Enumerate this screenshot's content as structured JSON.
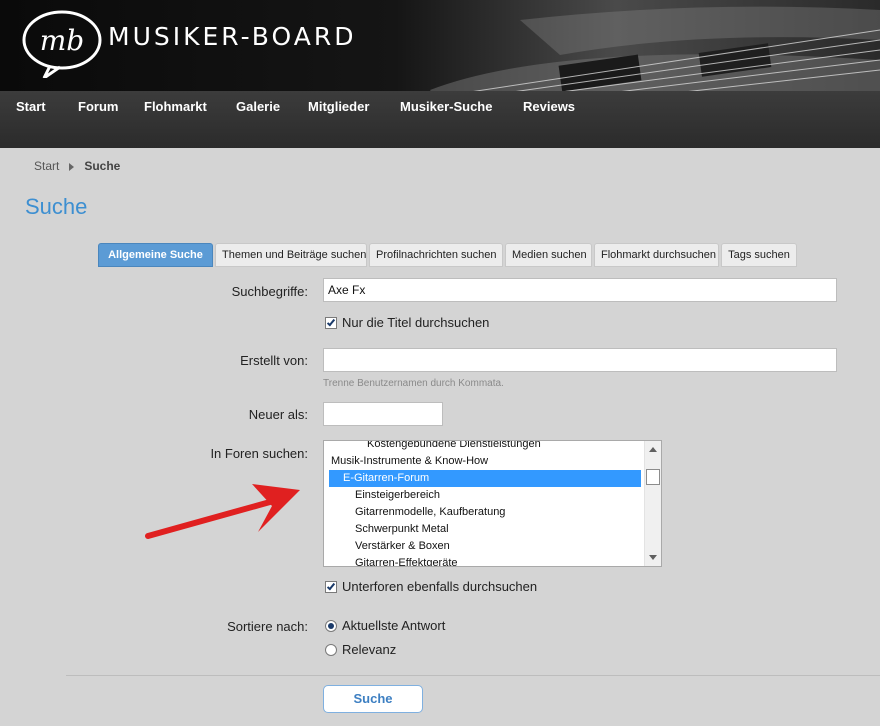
{
  "site": {
    "name": "MUSIKER-BOARD",
    "logo_mark": "mb"
  },
  "nav": {
    "items": [
      "Start",
      "Forum",
      "Flohmarkt",
      "Galerie",
      "Mitglieder",
      "Musiker-Suche",
      "Reviews"
    ]
  },
  "breadcrumb": {
    "home": "Start",
    "current": "Suche"
  },
  "page": {
    "title": "Suche"
  },
  "tabs": [
    {
      "label": "Allgemeine Suche",
      "active": true
    },
    {
      "label": "Themen und Beiträge suchen",
      "active": false
    },
    {
      "label": "Profilnachrichten suchen",
      "active": false
    },
    {
      "label": "Medien suchen",
      "active": false
    },
    {
      "label": "Flohmarkt durchsuchen",
      "active": false
    },
    {
      "label": "Tags suchen",
      "active": false
    }
  ],
  "form": {
    "keywords_label": "Suchbegriffe:",
    "keywords_value": "Axe Fx",
    "titles_only_label": "Nur die Titel durchsuchen",
    "titles_only_checked": true,
    "created_by_label": "Erstellt von:",
    "created_by_value": "",
    "created_by_hint": "Trenne Benutzernamen durch Kommata.",
    "newer_than_label": "Neuer als:",
    "newer_than_value": "",
    "forums_label": "In Foren suchen:",
    "forums": [
      {
        "label": "Kostengebundene Dienstleistungen",
        "selected": false
      },
      {
        "label": "Musik-Instrumente & Know-How",
        "selected": false
      },
      {
        "label": "E-Gitarren-Forum",
        "selected": true
      },
      {
        "label": "Einsteigerbereich",
        "selected": false
      },
      {
        "label": "Gitarrenmodelle, Kaufberatung",
        "selected": false
      },
      {
        "label": "Schwerpunkt Metal",
        "selected": false
      },
      {
        "label": "Verstärker & Boxen",
        "selected": false
      },
      {
        "label": "Gitarren-Effektgeräte",
        "selected": false
      }
    ],
    "subforums_label": "Unterforen ebenfalls durchsuchen",
    "subforums_checked": true,
    "sort_label": "Sortiere nach:",
    "sort_options": [
      {
        "label": "Aktuellste Antwort",
        "checked": true
      },
      {
        "label": "Relevanz",
        "checked": false
      }
    ],
    "submit_label": "Suche"
  },
  "colors": {
    "accent": "#3d8fd1",
    "tab_active": "#5b9bd5",
    "selection": "#3399ff",
    "annotation_arrow": "#e02020"
  }
}
